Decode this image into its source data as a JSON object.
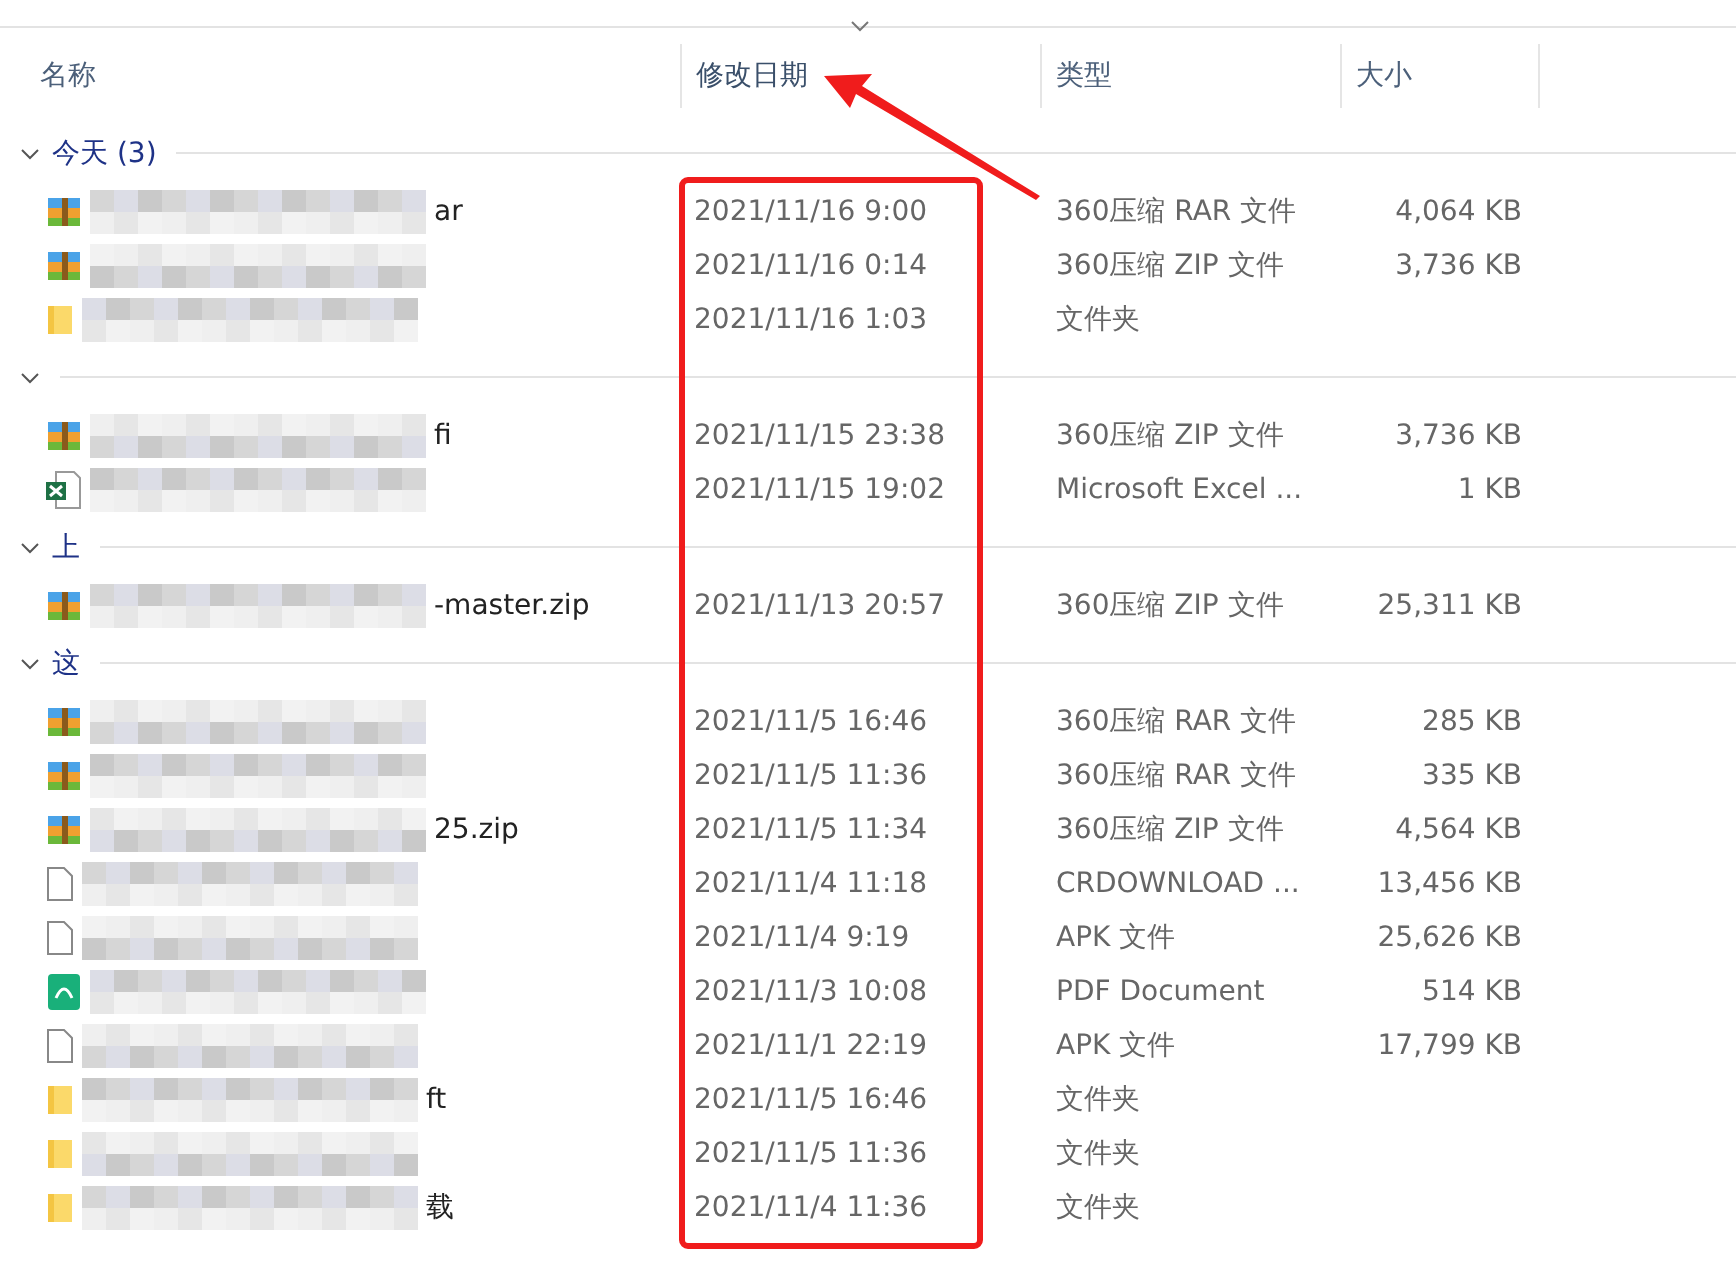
{
  "columns": [
    {
      "label": "名称",
      "sorted": false
    },
    {
      "label": "修改日期",
      "sorted": true
    },
    {
      "label": "类型",
      "sorted": false
    },
    {
      "label": "大小",
      "sorted": false
    }
  ],
  "groups": [
    {
      "label": "今天 (3)",
      "expanded": true,
      "rows": [
        {
          "kind": "rar",
          "name": "ar",
          "date": "2021/11/16 9:00",
          "type": "360压缩 RAR 文件",
          "size": "4,064 KB"
        },
        {
          "kind": "zip",
          "date": "2021/11/16 0:14",
          "type": "360压缩 ZIP 文件",
          "size": "3,736 KB"
        },
        {
          "kind": "folder",
          "date": "2021/11/16 1:03",
          "type": "文件夹"
        }
      ]
    },
    {
      "expanded": true,
      "rows": [
        {
          "kind": "zip",
          "name": "fi",
          "date": "2021/11/15 23:38",
          "type": "360压缩 ZIP 文件",
          "size": "3,736 KB"
        },
        {
          "kind": "excel",
          "date": "2021/11/15 19:02",
          "type": "Microsoft Excel ...",
          "size": "1 KB"
        }
      ]
    },
    {
      "label": "上",
      "expanded": true,
      "rows": [
        {
          "kind": "zip",
          "name": "-master.zip",
          "date": "2021/11/13 20:57",
          "type": "360压缩 ZIP 文件",
          "size": "25,311 KB"
        }
      ]
    },
    {
      "label": "这",
      "expanded": true,
      "rows": [
        {
          "kind": "rar",
          "date": "2021/11/5 16:46",
          "type": "360压缩 RAR 文件",
          "size": "285 KB"
        },
        {
          "kind": "rar",
          "date": "2021/11/5 11:36",
          "type": "360压缩 RAR 文件",
          "size": "335 KB"
        },
        {
          "kind": "zip",
          "name": "25.zip",
          "date": "2021/11/5 11:34",
          "type": "360压缩 ZIP 文件",
          "size": "4,564 KB"
        },
        {
          "kind": "file",
          "date": "2021/11/4 11:18",
          "type": "CRDOWNLOAD ...",
          "size": "13,456 KB"
        },
        {
          "kind": "file",
          "date": "2021/11/4 9:19",
          "type": "APK 文件",
          "size": "25,626 KB"
        },
        {
          "kind": "pdf",
          "date": "2021/11/3 10:08",
          "type": "PDF Document",
          "size": "514 KB"
        },
        {
          "kind": "file",
          "date": "2021/11/1 22:19",
          "type": "APK 文件",
          "size": "17,799 KB"
        },
        {
          "kind": "folder",
          "name": "ft",
          "date": "2021/11/5 16:46",
          "type": "文件夹"
        },
        {
          "kind": "folder",
          "date": "2021/11/5 11:36",
          "type": "文件夹"
        },
        {
          "kind": "folder",
          "name": "载",
          "date": "2021/11/4 11:36",
          "type": "文件夹"
        }
      ]
    }
  ]
}
